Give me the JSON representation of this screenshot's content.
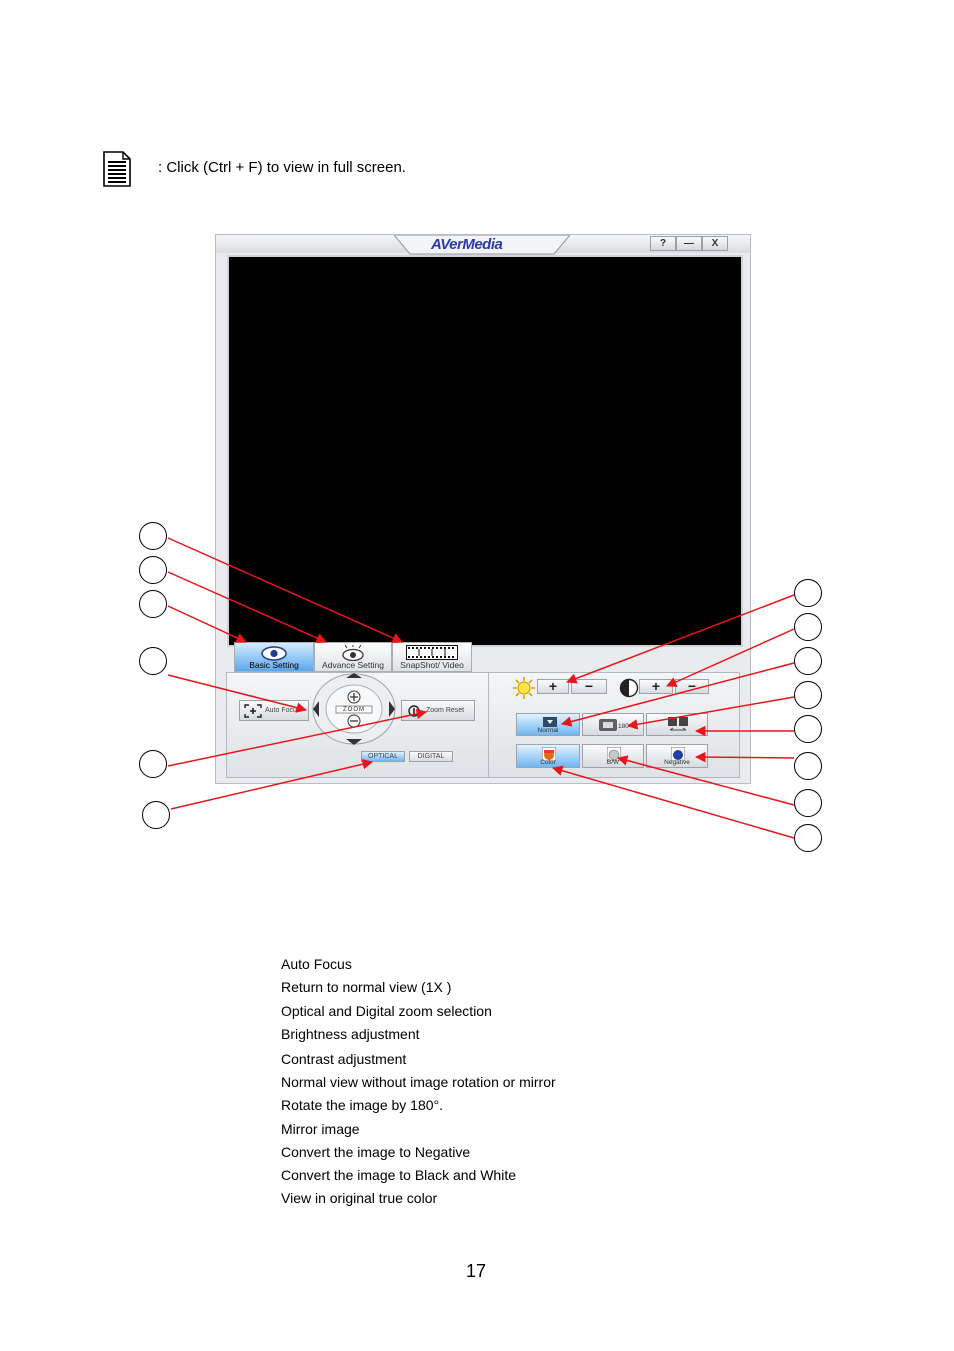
{
  "note": {
    "icon": "document-note-icon",
    "text": ": Click (Ctrl + F) to view in full screen."
  },
  "app": {
    "logo": "AVerMedia",
    "window_buttons": [
      "?",
      "—",
      "X"
    ],
    "tabs": [
      {
        "label": "Basic Setting",
        "active": true,
        "icon": "eye-icon"
      },
      {
        "label": "Advance Setting",
        "active": false,
        "icon": "eye-gear-icon"
      },
      {
        "label": "SnapShot/ Video",
        "active": false,
        "icon": "film-strip-icon"
      }
    ],
    "basic": {
      "auto_focus_label": "Auto Focus",
      "zoom_label": "ZOOM",
      "zoom_reset_label": "Zoom Reset",
      "optical_label": "OPTICAL",
      "digital_label": "DIGITAL"
    },
    "image": {
      "brightness_icon": "sun-icon",
      "contrast_icon": "contrast-icon",
      "plus": "+",
      "minus": "−",
      "normal_label": "Normal",
      "rotate_label": "180°",
      "color_label": "Color",
      "bw_label": "B/W",
      "negative_label": "Negative"
    },
    "accent_color": "#5aa7ee",
    "arrow_color": "#e8151b"
  },
  "legend": [
    "Auto Focus",
    "Return to normal view (1X )",
    "Optical and Digital zoom selection",
    "Brightness adjustment",
    "Contrast adjustment",
    "Normal view without image rotation or mirror",
    "Rotate the image by 180°.",
    "Mirror image",
    "Convert the image to Negative",
    "Convert the image to Black and White",
    "View in original true color"
  ],
  "page_number": "17"
}
